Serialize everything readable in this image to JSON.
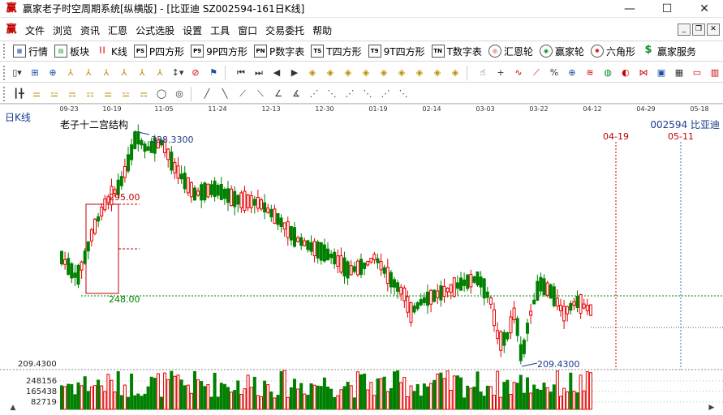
{
  "window": {
    "title": "赢家老子时空周期系统[纵横版] - [比亚迪  SZ002594-161日K线]",
    "minimize": "—",
    "maximize": "☐",
    "close": "✕"
  },
  "menu": [
    "文件",
    "浏览",
    "资讯",
    "汇恩",
    "公式选股",
    "设置",
    "工具",
    "窗口",
    "交易委托",
    "帮助"
  ],
  "toolbar1": [
    {
      "label": "行情",
      "icon": "grid"
    },
    {
      "label": "板块",
      "icon": "blocks"
    },
    {
      "label": "K线",
      "icon": "kline"
    },
    {
      "label": "P四方形",
      "icon": "PS"
    },
    {
      "label": "9P四方形",
      "icon": "P9"
    },
    {
      "label": "P数字表",
      "icon": "PN"
    },
    {
      "label": "T四方形",
      "icon": "TS"
    },
    {
      "label": "9T四方形",
      "icon": "T9"
    },
    {
      "label": "T数字表",
      "icon": "TN"
    },
    {
      "label": "汇恩轮",
      "icon": "wheel"
    },
    {
      "label": "赢家轮",
      "icon": "wheel2"
    },
    {
      "label": "六角形",
      "icon": "hex"
    },
    {
      "label": "赢家服务",
      "icon": "dollar"
    }
  ],
  "chart": {
    "period_label": "日K线",
    "indicator": "老子十二宫结构",
    "stock": "002594  比亚迪",
    "dates": [
      "09-23",
      "10-19",
      "11-05",
      "11-24",
      "12-13",
      "12-30",
      "01-19",
      "02-14",
      "03-03",
      "03-22",
      "04-12",
      "04-29",
      "05-18"
    ],
    "future_dates": [
      "04-19",
      "05-11"
    ],
    "high_price": "338.3300",
    "box_top": "295.00",
    "box_bottom": "248.00",
    "low_price": "209.4300",
    "axis_price": "209.4300",
    "volume_labels": [
      "248156",
      "165438",
      "82719"
    ]
  },
  "chart_data": {
    "type": "candlestick",
    "ylim": [
      209.43,
      338.33
    ],
    "up_color": "#e60000",
    "down_color": "#008000",
    "bg_color": "#ffffff",
    "level_line": 248.0
  }
}
